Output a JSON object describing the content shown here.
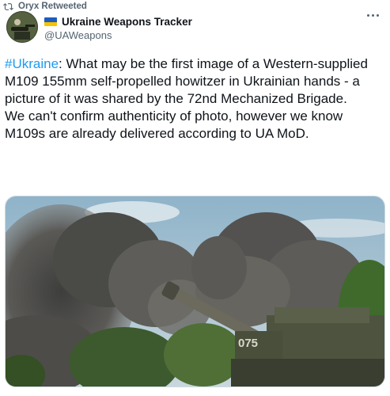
{
  "retweet": {
    "icon": "retweet-icon",
    "label": "Oryx Retweeted"
  },
  "author": {
    "flag_icon": "ukraine-flag-icon",
    "name": "Ukraine Weapons Tracker",
    "handle": "@UAWeapons"
  },
  "more_icon": "more-options-icon",
  "tweet": {
    "hashtag": "#Ukraine",
    "body": ": What may be the first image of a Western-supplied M109 155mm self-propelled howitzer in Ukrainian hands - a picture of it was shared by the 72nd Mechanized Brigade.\nWe can't confirm authenticity of photo, however we know M109s are already delivered according to UA MoD."
  },
  "media": {
    "vehicle_number": "075"
  },
  "colors": {
    "link": "#1d9bf0",
    "muted": "#536471",
    "text": "#0f1419"
  }
}
